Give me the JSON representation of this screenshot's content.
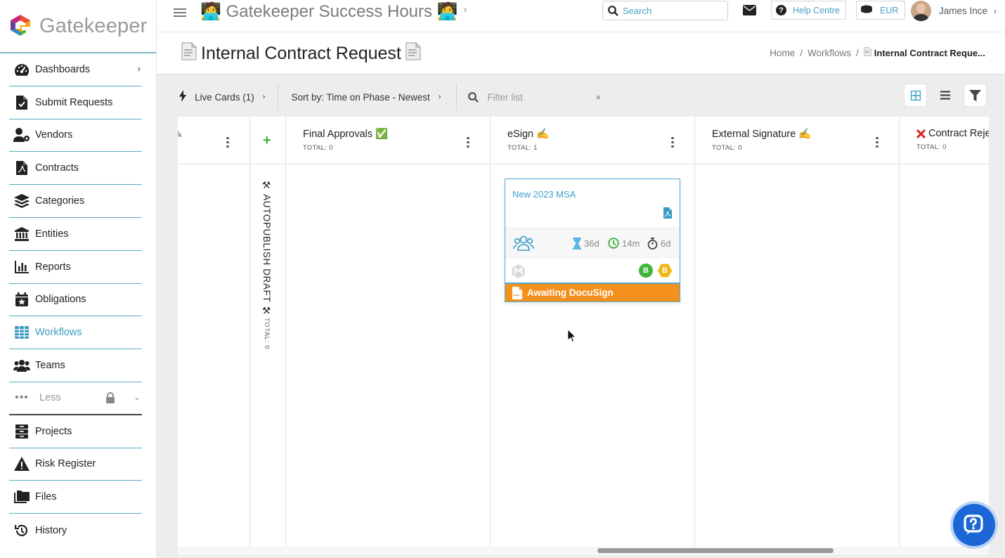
{
  "brand": {
    "name": "Gatekeeper",
    "accent": "#3a9cc2"
  },
  "topbar": {
    "title": "🧑‍💻 Gatekeeper Success Hours 🧑‍💻",
    "search_placeholder": "Search",
    "help_label": "Help Centre",
    "currency": "EUR",
    "user_name": "James Ince"
  },
  "sidebar": {
    "items": [
      {
        "label": "Dashboards",
        "icon": "gauge-icon",
        "has_chevron": true
      },
      {
        "label": "Submit Requests",
        "icon": "file-check-icon"
      },
      {
        "label": "Vendors",
        "icon": "user-gear-icon"
      },
      {
        "label": "Contracts",
        "icon": "file-pdf-icon"
      },
      {
        "label": "Categories",
        "icon": "layers-icon"
      },
      {
        "label": "Entities",
        "icon": "bank-icon"
      },
      {
        "label": "Reports",
        "icon": "bar-chart-icon"
      },
      {
        "label": "Obligations",
        "icon": "calendar-star-icon"
      },
      {
        "label": "Workflows",
        "icon": "table-grid-icon",
        "active": true
      },
      {
        "label": "Teams",
        "icon": "users-icon"
      },
      {
        "label": "Less",
        "icon": "ellipsis-icon"
      },
      {
        "label": "Projects",
        "icon": "archive-icon"
      },
      {
        "label": "Risk Register",
        "icon": "warning-icon"
      },
      {
        "label": "Files",
        "icon": "folders-icon"
      },
      {
        "label": "History",
        "icon": "history-icon"
      }
    ]
  },
  "page": {
    "title": "Internal Contract Request",
    "breadcrumb": {
      "home": "Home",
      "workflows": "Workflows",
      "current": "Internal Contract Reque..."
    }
  },
  "toolbar": {
    "live_cards": "Live Cards (1)",
    "sort": "Sort by: Time on Phase - Newest",
    "filter_placeholder": "Filter list",
    "clear": "×"
  },
  "board": {
    "columns": [
      {
        "title": "Final Approvals ✅",
        "total": "TOTAL: 0"
      },
      {
        "title": "eSign ✍️",
        "total": "TOTAL: 1"
      },
      {
        "title": "External Signature ✍️",
        "total": "TOTAL: 0"
      },
      {
        "title": "Contract Reje",
        "total": "TOTAL: 0"
      }
    ],
    "collapsed": {
      "title": "⚒ AUTOPUBLISH DRAFT ⚒",
      "total": "TOTAL: 0"
    },
    "card": {
      "title": "New 2023 MSA",
      "metrics": {
        "phase_time": "36d",
        "clock_time": "14m",
        "timer": "6d"
      },
      "badges": [
        "B",
        "B"
      ],
      "status": "Awaiting DocuSign",
      "status_color": "#f4911e"
    }
  }
}
